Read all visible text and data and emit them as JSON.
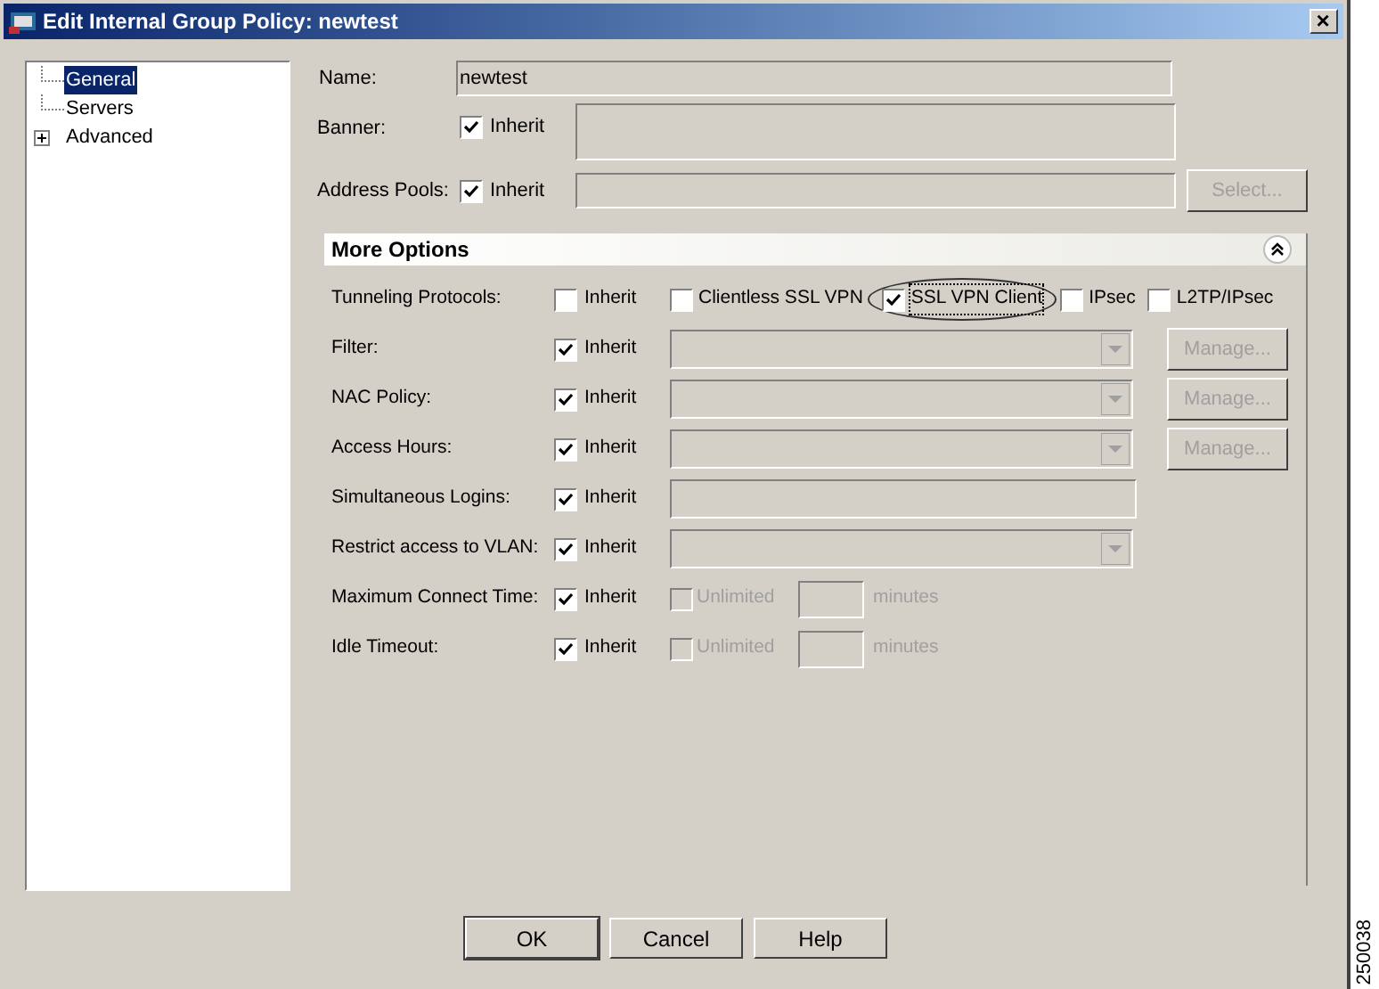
{
  "window": {
    "title": "Edit Internal Group Policy: newtest",
    "close": "×"
  },
  "tree": [
    {
      "label": "General",
      "selected": true,
      "expandable": false
    },
    {
      "label": "Servers",
      "selected": false,
      "expandable": false
    },
    {
      "label": "Advanced",
      "selected": false,
      "expandable": true
    }
  ],
  "name": {
    "label": "Name:",
    "value": "newtest"
  },
  "banner": {
    "label": "Banner:",
    "inherit": {
      "label": "Inherit",
      "checked": true
    }
  },
  "address_pools": {
    "label": "Address Pools:",
    "inherit": {
      "label": "Inherit",
      "checked": true
    },
    "button": {
      "label": "Select...",
      "disabled": true
    }
  },
  "more_options": {
    "title": "More Options",
    "expanded": true,
    "rows": [
      {
        "kind": "protocols",
        "label": "Tunneling Protocols:",
        "inherit": {
          "label": "Inherit",
          "checked": false
        },
        "protocols": [
          {
            "label": "Clientless SSL VPN",
            "checked": false,
            "circled": false
          },
          {
            "label": "SSL VPN Client",
            "checked": true,
            "circled": true
          },
          {
            "label": "IPsec",
            "checked": false,
            "circled": false
          },
          {
            "label": "L2TP/IPsec",
            "checked": false,
            "circled": false
          }
        ]
      },
      {
        "kind": "select",
        "label": "Filter:",
        "inherit": {
          "label": "Inherit",
          "checked": true
        },
        "button": {
          "label": "Manage...",
          "disabled": true
        }
      },
      {
        "kind": "select",
        "label": "NAC Policy:",
        "inherit": {
          "label": "Inherit",
          "checked": true
        },
        "button": {
          "label": "Manage...",
          "disabled": true
        }
      },
      {
        "kind": "select",
        "label": "Access Hours:",
        "inherit": {
          "label": "Inherit",
          "checked": true
        },
        "button": {
          "label": "Manage...",
          "disabled": true
        }
      },
      {
        "kind": "text",
        "label": "Simultaneous Logins:",
        "inherit": {
          "label": "Inherit",
          "checked": true
        }
      },
      {
        "kind": "select",
        "label": "Restrict access to VLAN:",
        "inherit": {
          "label": "Inherit",
          "checked": true
        }
      },
      {
        "kind": "time",
        "label": "Maximum Connect Time:",
        "inherit": {
          "label": "Inherit",
          "checked": true
        },
        "unlimited": {
          "label": "Unlimited",
          "checked": false,
          "disabled": true
        },
        "unit": "minutes"
      },
      {
        "kind": "time",
        "label": "Idle Timeout:",
        "inherit": {
          "label": "Inherit",
          "checked": true
        },
        "unlimited": {
          "label": "Unlimited",
          "checked": false,
          "disabled": true
        },
        "unit": "minutes"
      }
    ]
  },
  "buttons": [
    "OK",
    "Cancel",
    "Help"
  ],
  "figure_id": "250038"
}
